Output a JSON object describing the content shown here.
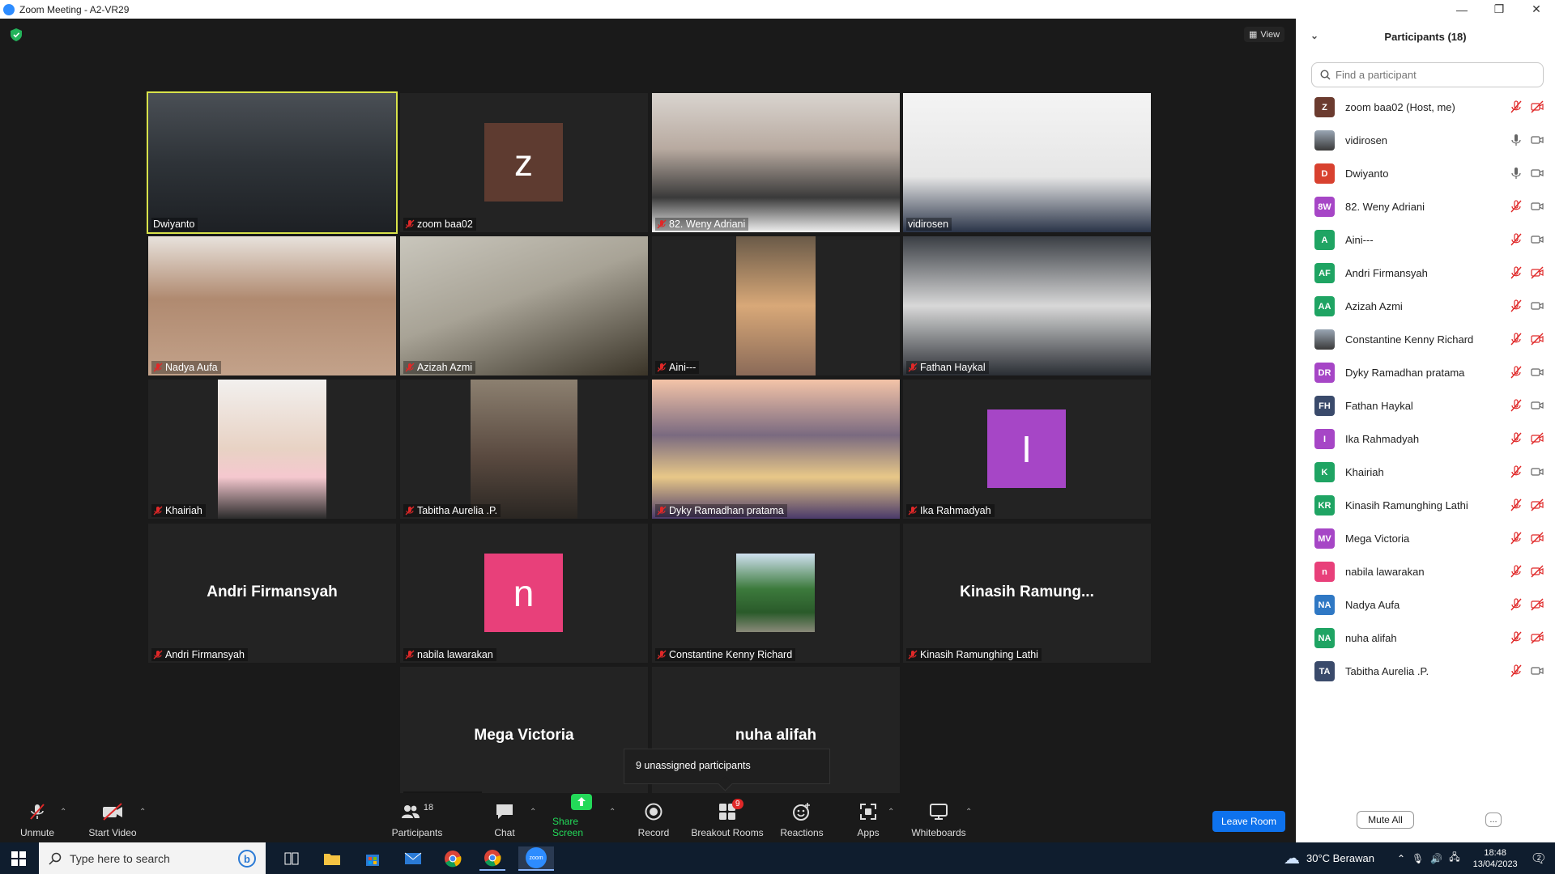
{
  "window": {
    "title": "Zoom Meeting - A2-VR29"
  },
  "meeting": {
    "view_label": "View",
    "tooltip": "9 unassigned participants",
    "tiles": [
      {
        "name": "Dwiyanto",
        "kind": "video",
        "muted": false,
        "active": true
      },
      {
        "name": "zoom baa02",
        "kind": "avatar",
        "letter": "z",
        "color": "#5e3b30",
        "muted": true
      },
      {
        "name": "82. Weny Adriani",
        "kind": "video",
        "muted": true
      },
      {
        "name": "vidirosen",
        "kind": "video",
        "muted": false
      },
      {
        "name": "Nadya Aufa",
        "kind": "video",
        "muted": true
      },
      {
        "name": "Azizah Azmi",
        "kind": "video",
        "muted": true
      },
      {
        "name": "Aini---",
        "kind": "video",
        "muted": true
      },
      {
        "name": "Fathan Haykal",
        "kind": "video",
        "muted": true
      },
      {
        "name": "Khairiah",
        "kind": "video",
        "muted": true
      },
      {
        "name": "Tabitha Aurelia .P.",
        "kind": "video",
        "muted": true
      },
      {
        "name": "Dyky Ramadhan pratama",
        "kind": "video",
        "muted": true
      },
      {
        "name": "Ika Rahmadyah",
        "kind": "avatar",
        "letter": "I",
        "color": "#a646c6",
        "muted": true
      },
      {
        "name": "Andri Firmansyah",
        "kind": "text",
        "big": "Andri Firmansyah",
        "muted": true
      },
      {
        "name": "nabila lawarakan",
        "kind": "avatar",
        "letter": "n",
        "color": "#e8407a",
        "muted": true
      },
      {
        "name": "Constantine Kenny Richard",
        "kind": "photo",
        "muted": true
      },
      {
        "name": "Kinasih Ramunghing Lathi",
        "kind": "text",
        "big": "Kinasih  Ramung...",
        "muted": true
      },
      {
        "name": "Mega Victoria",
        "kind": "text",
        "big": "Mega Victoria",
        "muted": true
      },
      {
        "name": "",
        "kind": "text",
        "big": "nuha alifah",
        "muted": false
      }
    ]
  },
  "toolbar": {
    "unmute": "Unmute",
    "start_video": "Start Video",
    "participants": "Participants",
    "participants_count": "18",
    "chat": "Chat",
    "share_screen": "Share Screen",
    "record": "Record",
    "breakout_rooms": "Breakout Rooms",
    "breakout_badge": "9",
    "reactions": "Reactions",
    "apps": "Apps",
    "whiteboards": "Whiteboards",
    "leave": "Leave Room",
    "share_color": "#23d959"
  },
  "panel": {
    "title": "Participants (18)",
    "search_placeholder": "Find a participant",
    "mute_all": "Mute All",
    "more": "...",
    "participants": [
      {
        "initials": "Z",
        "name": "zoom baa02 (Host, me)",
        "color": "#6b3b2f",
        "mic": "off",
        "video": "off"
      },
      {
        "initials": "",
        "name": "vidirosen",
        "color": "#7a7a7a",
        "mic": "on",
        "video": "on",
        "photo": true
      },
      {
        "initials": "D",
        "name": "Dwiyanto",
        "color": "#d8412f",
        "mic": "on",
        "video": "on"
      },
      {
        "initials": "8W",
        "name": "82. Weny Adriani",
        "color": "#a646c6",
        "mic": "off",
        "video": "on"
      },
      {
        "initials": "A",
        "name": "Aini---",
        "color": "#1fa463",
        "mic": "off",
        "video": "on"
      },
      {
        "initials": "AF",
        "name": "Andri Firmansyah",
        "color": "#1fa463",
        "mic": "off",
        "video": "off"
      },
      {
        "initials": "AA",
        "name": "Azizah Azmi",
        "color": "#1fa463",
        "mic": "off",
        "video": "on"
      },
      {
        "initials": "",
        "name": "Constantine Kenny Richard",
        "color": "#2e4a2e",
        "mic": "off",
        "video": "off",
        "photo": true
      },
      {
        "initials": "DR",
        "name": "Dyky Ramadhan pratama",
        "color": "#a646c6",
        "mic": "off",
        "video": "on"
      },
      {
        "initials": "FH",
        "name": "Fathan Haykal",
        "color": "#3a4a6b",
        "mic": "off",
        "video": "on"
      },
      {
        "initials": "I",
        "name": "Ika Rahmadyah",
        "color": "#a646c6",
        "mic": "off",
        "video": "off"
      },
      {
        "initials": "K",
        "name": "Khairiah",
        "color": "#1fa463",
        "mic": "off",
        "video": "on"
      },
      {
        "initials": "KR",
        "name": "Kinasih Ramunghing Lathi",
        "color": "#1fa463",
        "mic": "off",
        "video": "off"
      },
      {
        "initials": "MV",
        "name": "Mega Victoria",
        "color": "#a646c6",
        "mic": "off",
        "video": "off"
      },
      {
        "initials": "n",
        "name": "nabila lawarakan",
        "color": "#e8407a",
        "mic": "off",
        "video": "off"
      },
      {
        "initials": "NA",
        "name": "Nadya Aufa",
        "color": "#2f78c4",
        "mic": "off",
        "video": "off"
      },
      {
        "initials": "NA",
        "name": "nuha alifah",
        "color": "#1fa463",
        "mic": "off",
        "video": "off"
      },
      {
        "initials": "TA",
        "name": "Tabitha Aurelia .P.",
        "color": "#3a4a6b",
        "mic": "off",
        "video": "on"
      }
    ]
  },
  "taskbar": {
    "search_placeholder": "Type here to search",
    "weather": "30°C  Berawan",
    "time": "18:48",
    "date": "13/04/2023",
    "notif_count": "2"
  }
}
